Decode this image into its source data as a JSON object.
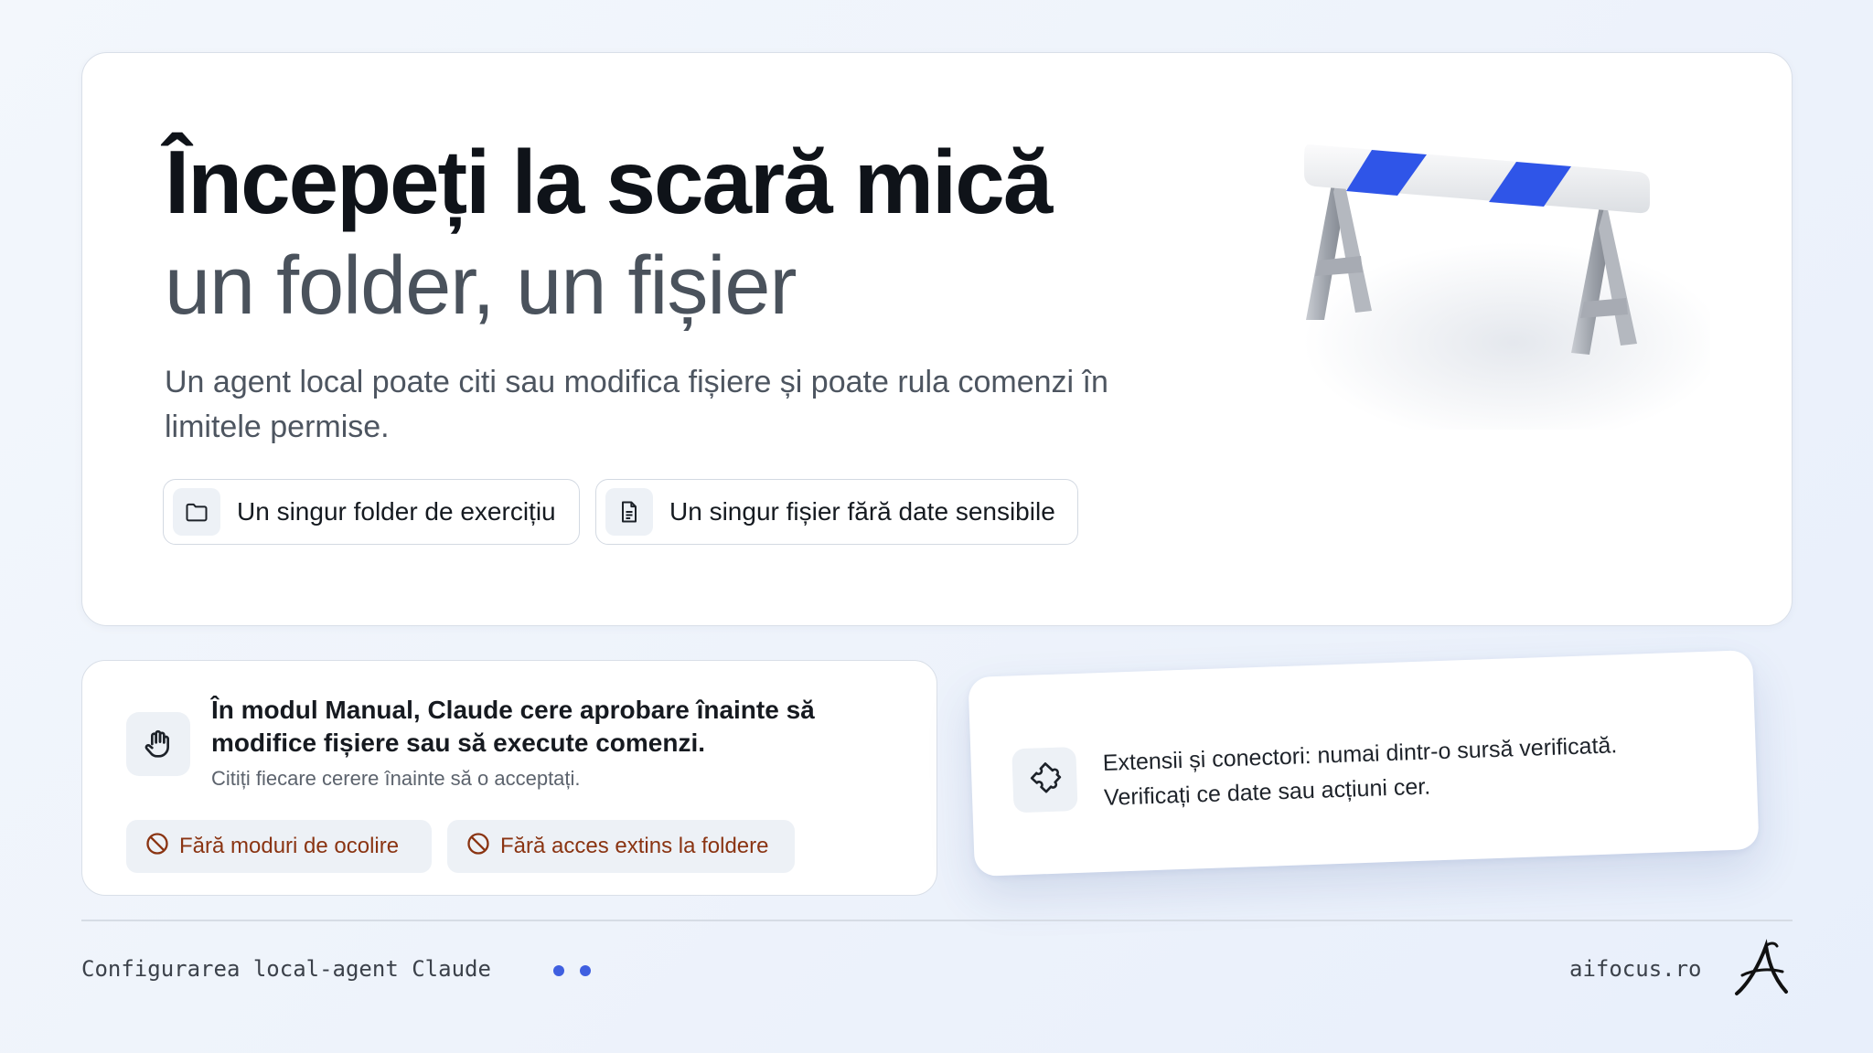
{
  "hero": {
    "title": "Începeți la scară mică",
    "subtitle": "un folder, un fișier",
    "description": "Un agent local poate citi sau modifica fișiere și poate rula comenzi în limitele permise.",
    "chips": [
      {
        "label": "Un singur folder de exercițiu",
        "icon": "folder-icon"
      },
      {
        "label": "Un singur fișier fără date sensibile",
        "icon": "document-icon"
      }
    ],
    "illustration": "barrier-illustration"
  },
  "manual_card": {
    "icon": "hand-icon",
    "title": "În modul Manual, Claude cere aprobare înainte să modifice fișiere sau să execute comenzi.",
    "note": "Citiți fiecare cerere înainte să o acceptați.",
    "pills": [
      {
        "label": "Fără moduri de ocolire",
        "icon": "no-entry-icon"
      },
      {
        "label": "Fără acces extins la foldere",
        "icon": "no-entry-icon"
      }
    ]
  },
  "extensions_card": {
    "icon": "puzzle-icon",
    "line1": "Extensii și conectori: numai dintr-o sursă verificată.",
    "line2": "Verificați ce date sau acțiuni cer."
  },
  "footer": {
    "left_text": "Configurarea local-agent Claude",
    "right_text": "aifocus.ro",
    "logo": "aifocus-logo"
  },
  "colors": {
    "accent": "#3f5fe0",
    "warning_text": "#8a3412",
    "barrier_stripe": "#2f55e8"
  }
}
